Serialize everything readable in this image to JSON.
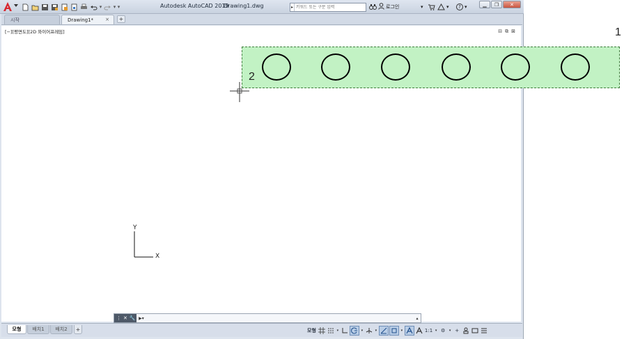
{
  "titlebar": {
    "app_title": "Autodesk AutoCAD 2019",
    "doc_title": "Drawing1.dwg",
    "search_placeholder": "키워드 또는 구문 입력",
    "login_label": "로그인",
    "help_label": "?"
  },
  "tabs": {
    "start_label": "시작",
    "drawing_label": "Drawing1*",
    "close_glyph": "×",
    "add_glyph": "+"
  },
  "viewport": {
    "label": "[−][평면도][2D 와이어프레임]",
    "controls": [
      "⊟",
      "⧉",
      "⊠"
    ]
  },
  "ucs": {
    "x_label": "X",
    "y_label": "Y"
  },
  "command_line": {
    "handle_glyphs": [
      "⋮",
      "✕",
      "🔧"
    ],
    "prompt_glyph": "▶▾",
    "input_value": "",
    "history_glyph": "▴"
  },
  "layout_tabs": [
    "모형",
    "배치1",
    "배치2",
    "+"
  ],
  "status": {
    "model_label": "모형",
    "scale_label": "1:1",
    "items": [
      "#",
      "⋯",
      "L",
      "G",
      "∠",
      "□",
      "A",
      "⚙",
      "+"
    ]
  },
  "selection": {
    "fill_color": "#c2f2c4",
    "border_color": "#3f7d3c",
    "circle_count": 6
  },
  "annotations": {
    "label_1": "1",
    "label_2": "2"
  }
}
